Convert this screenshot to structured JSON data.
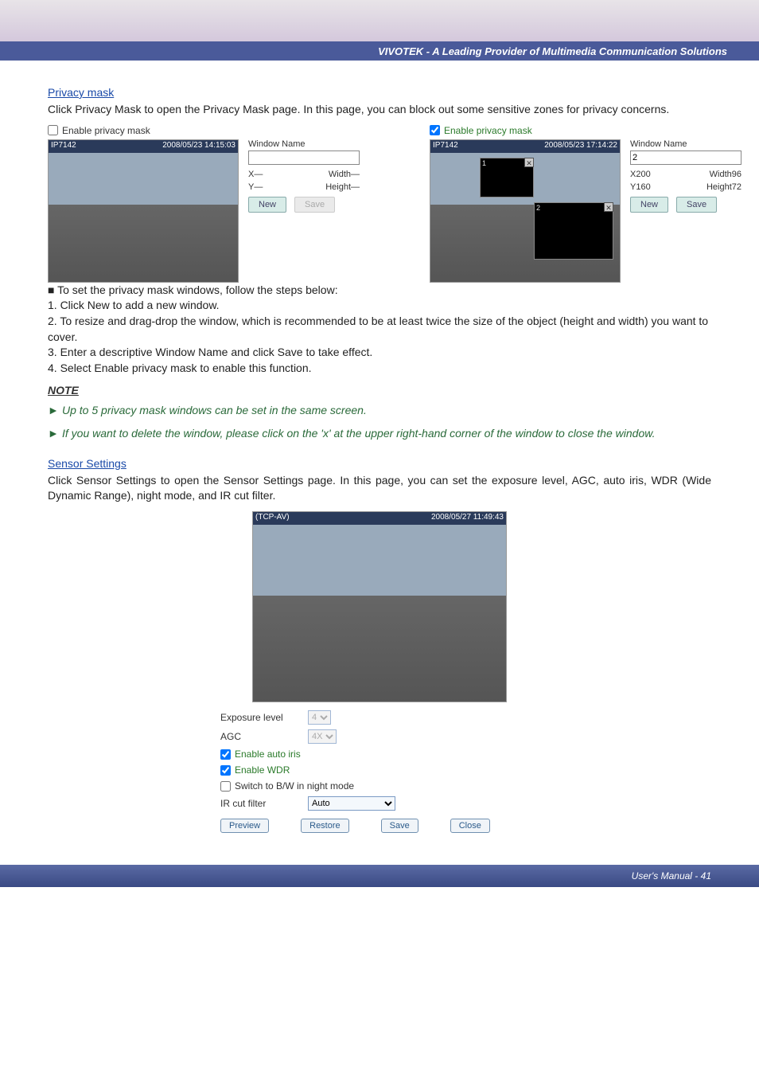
{
  "header": {
    "company_line": "VIVOTEK - A Leading Provider of Multimedia Communication Solutions"
  },
  "privacy_mask": {
    "title": "Privacy mask",
    "intro": "Click Privacy Mask to open the Privacy Mask page. In this page, you can block out some sensitive zones for privacy concerns.",
    "enable_label": "Enable privacy mask",
    "left_panel": {
      "cam_name": "IP7142",
      "timestamp": "2008/05/23 14:15:03",
      "window_name_label": "Window Name",
      "window_name_value": "",
      "x_label": "X—",
      "y_label": "Y—",
      "w_label": "Width—",
      "h_label": "Height—",
      "new_btn": "New",
      "save_btn": "Save"
    },
    "right_panel": {
      "cam_name": "IP7142",
      "timestamp": "2008/05/23 17:14:22",
      "window_name_label": "Window Name",
      "window_name_value": "2",
      "x_label": "X200",
      "y_label": "Y160",
      "w_label": "Width96",
      "h_label": "Height72",
      "new_btn": "New",
      "save_btn": "Save",
      "mask1_label": "1",
      "mask2_label": "2"
    },
    "steps_lead": "To set the privacy mask windows, follow the steps below:",
    "steps": [
      "1. Click New to add a new window.",
      "2. To resize and drag-drop the window, which is recommended to be at least twice the size of the object (height and width) you want to cover.",
      "3. Enter a descriptive Window Name and click Save to take effect.",
      "4. Select Enable privacy mask to enable this function."
    ],
    "note_hd": "NOTE",
    "note1": "Up to 5 privacy mask windows can be set in the same screen.",
    "note2": "If you want to delete the window, please click on the 'x' at the upper right-hand corner of the window to close the window."
  },
  "sensor": {
    "title": "Sensor Settings",
    "intro": "Click Sensor Settings to open the Sensor Settings page. In this page, you can set the exposure level, AGC, auto iris, WDR (Wide Dynamic Range), night mode, and IR cut filter.",
    "cam_name": "(TCP-AV)",
    "timestamp": "2008/05/27 11:49:43",
    "exposure_label": "Exposure level",
    "exposure_value": "4",
    "agc_label": "AGC",
    "agc_value": "4X",
    "auto_iris_label": "Enable auto iris",
    "wdr_label": "Enable WDR",
    "bw_label": "Switch to B/W in night mode",
    "ir_label": "IR cut filter",
    "ir_value": "Auto",
    "preview_btn": "Preview",
    "restore_btn": "Restore",
    "save_btn": "Save",
    "close_btn": "Close"
  },
  "footer": {
    "text": "User's Manual - 41"
  }
}
